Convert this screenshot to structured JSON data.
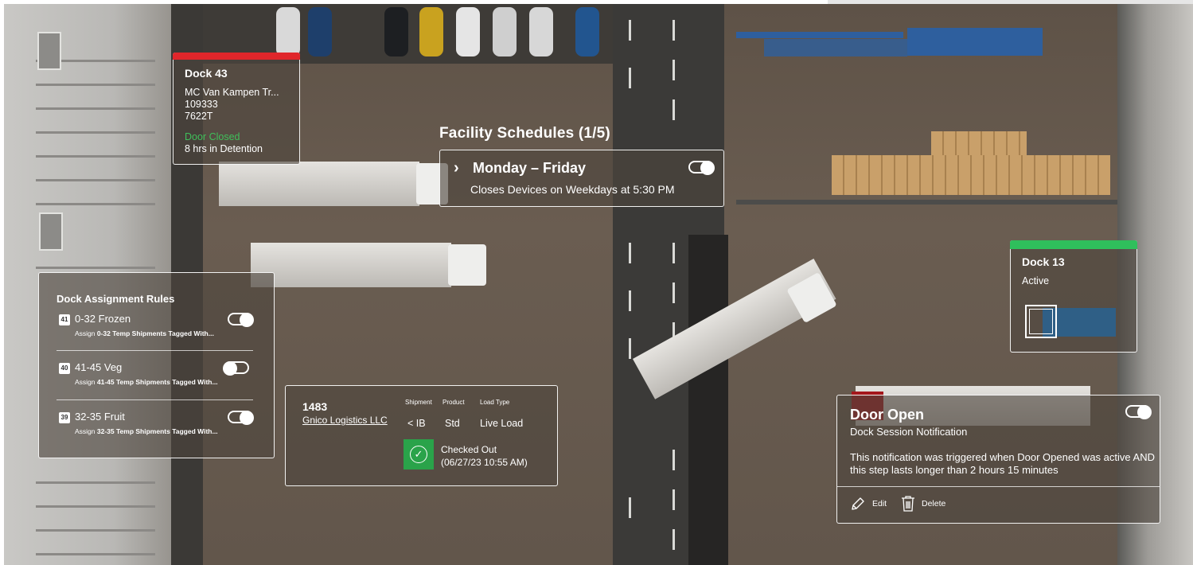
{
  "dock43": {
    "title": "Dock 43",
    "carrier": "MC Van Kampen Tr...",
    "number1": "109333",
    "number2": "7622T",
    "door_status": "Door Closed",
    "detention": "8 hrs in Detention",
    "accent_color": "#e0262b",
    "status_color": "#3fbf5a"
  },
  "facility_schedules": {
    "title": "Facility Schedules (1/5)",
    "schedule_name": "Monday – Friday",
    "schedule_desc": "Closes Devices on Weekdays at 5:30 PM",
    "toggle_on": true,
    "chevron_icon": "chevron-right-icon"
  },
  "dock_rules": {
    "title": "Dock Assignment Rules",
    "rules": [
      {
        "badge": "41",
        "name": "0-32 Frozen",
        "desc_prefix": "Assign ",
        "desc_bold": "0-32 Temp Shipments Tagged With...",
        "enabled": true
      },
      {
        "badge": "40",
        "name": "41-45 Veg",
        "desc_prefix": "Assign ",
        "desc_bold": "41-45 Temp Shipments Tagged With...",
        "enabled": false
      },
      {
        "badge": "39",
        "name": "32-35 Fruit",
        "desc_prefix": "Assign ",
        "desc_bold": "32-35 Temp Shipments Tagged With...",
        "enabled": true
      }
    ]
  },
  "shipment": {
    "id": "1483",
    "carrier": "Gnico Logistics LLC",
    "headers": {
      "shipment": "Shipment",
      "product": "Product",
      "load_type": "Load Type"
    },
    "values": {
      "shipment": "< IB",
      "product": "Std",
      "load_type": "Live Load"
    },
    "status_line1": "Checked Out",
    "status_line2": "(06/27/23 10:55 AM)",
    "status_icon": "check-circle-icon",
    "status_color": "#2aa34a"
  },
  "dock13": {
    "title": "Dock 13",
    "state": "Active",
    "accent_color": "#2fbf5c"
  },
  "notification": {
    "title": "Door Open",
    "subtitle": "Dock Session Notification",
    "body": "This notification was triggered when Door Opened was active AND this step lasts longer than 2 hours 15 minutes",
    "toggle_on": true,
    "edit_label": "Edit",
    "delete_label": "Delete",
    "edit_icon": "pencil-icon",
    "delete_icon": "trash-icon"
  }
}
